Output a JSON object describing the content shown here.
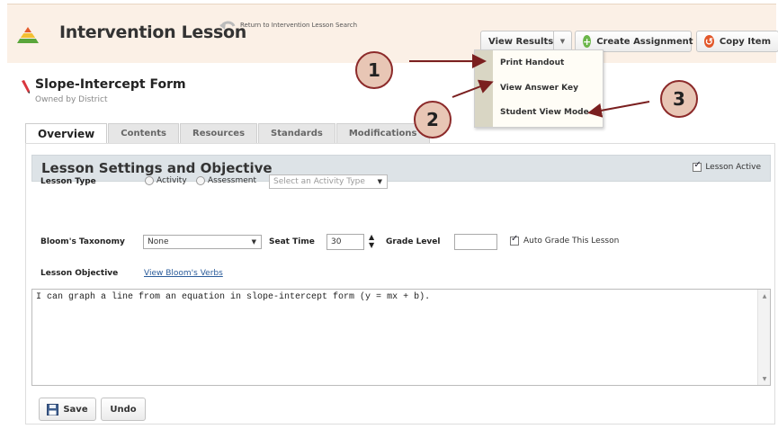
{
  "header": {
    "title": "Intervention Lesson",
    "return_link": "Return to Intervention Lesson Search",
    "view_results": "View Results",
    "create_assignment": "Create Assignment",
    "copy_item": "Copy Item"
  },
  "dropdown": {
    "items": [
      "Print Handout",
      "View Answer Key",
      "Student View Mode"
    ]
  },
  "lesson": {
    "name": "Slope-Intercept Form",
    "owner": "Owned by District"
  },
  "tabs": [
    "Overview",
    "Contents",
    "Resources",
    "Standards",
    "Modifications"
  ],
  "settings": {
    "section_title": "Lesson Settings and Objective",
    "lesson_active_label": "Lesson Active",
    "lesson_type_label": "Lesson Type",
    "activity_label": "Activity",
    "assessment_label": "Assessment",
    "activity_type_placeholder": "Select an Activity Type",
    "blooms_label": "Bloom's Taxonomy",
    "blooms_value": "None",
    "seat_time_label": "Seat Time",
    "seat_time_value": "30",
    "grade_level_label": "Grade Level",
    "grade_level_value": "",
    "auto_grade_label": "Auto Grade This Lesson",
    "objective_label": "Lesson Objective",
    "blooms_verbs_link": "View Bloom's Verbs",
    "objective_text": "I can graph a line from an equation in slope-intercept form (y = mx + b)."
  },
  "buttons": {
    "save": "Save",
    "undo": "Undo"
  },
  "callouts": [
    "1",
    "2",
    "3"
  ],
  "colors": {
    "header_bg": "#fbf0e6",
    "section_bar": "#dde3e7",
    "callout_fill": "#e8c6b5",
    "arrow": "#7a1f1f",
    "create_icon": "#6bb64a",
    "copy_icon": "#e2572a"
  },
  "icons": {
    "logo": "pyramid-logo-icon",
    "return": "return-arrow-icon",
    "create": "plus-circle-icon",
    "copy": "copy-circle-icon",
    "pencil": "pencil-icon",
    "save": "floppy-disk-icon"
  }
}
